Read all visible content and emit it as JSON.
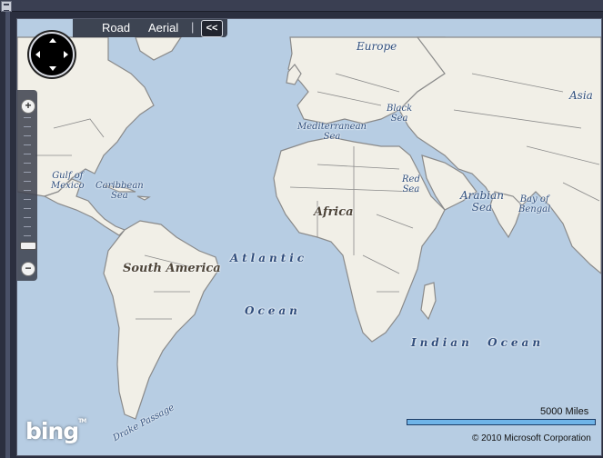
{
  "nav": {
    "road": "Road",
    "aerial": "Aerial",
    "separator": "|",
    "collapse": "<<"
  },
  "labels": {
    "europe": "Europe",
    "asia": "Asia",
    "black_sea": "Black\nSea",
    "mediterranean": "Mediterranean\nSea",
    "gulf_mexico": "Gulf of\nMexico",
    "caribbean": "Caribbean\nSea",
    "red_sea": "Red\nSea",
    "arabian_sea": "Arabian\nSea",
    "bay_bengal": "Bay of\nBengal",
    "africa": "Africa",
    "south_america": "South America",
    "atlantic": "Atlantic",
    "ocean": "Ocean",
    "indian_ocean": "Indian  Ocean",
    "drake_passage": "Drake Passage"
  },
  "logo": {
    "text": "bing"
  },
  "scale": {
    "label": "5000 Miles"
  },
  "copyright": "© 2010 Microsoft Corporation",
  "colors": {
    "water": "#b7cde3",
    "land": "#f1efe7",
    "border": "#7b7b7b",
    "scalebar": "#6fb4e8"
  },
  "icons": [
    "compass-icon",
    "zoom-in-icon",
    "zoom-out-icon",
    "collapse-icon"
  ]
}
